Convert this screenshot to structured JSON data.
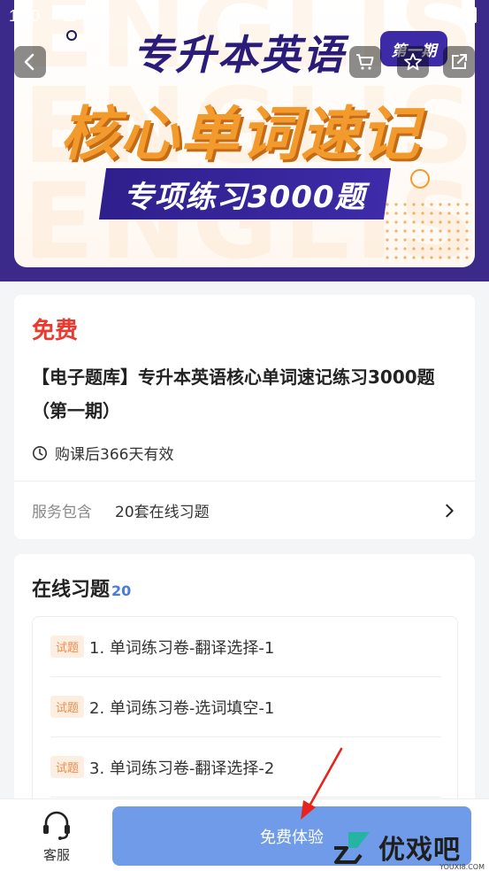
{
  "status_bar": {
    "time": "1:50"
  },
  "banner": {
    "title_line1": "专升本英语",
    "title_line2": "核心单词速记",
    "ribbon": "专项练习3000题",
    "issue_badge": "第一期",
    "watermark": "ENGLISH"
  },
  "course": {
    "price": "免费",
    "title": "【电子题库】专升本英语核心单词速记练习3000题（第一期）",
    "validity": "购课后366天有效",
    "service_label": "服务包含",
    "service_value": "20套在线习题"
  },
  "exercises": {
    "section_title": "在线习题",
    "count": "20",
    "items": [
      {
        "tag": "试题",
        "text": "1. 单词练习卷-翻译选择-1"
      },
      {
        "tag": "试题",
        "text": "2. 单词练习卷-选词填空-1"
      },
      {
        "tag": "试题",
        "text": "3. 单词练习卷-翻译选择-2"
      }
    ]
  },
  "bottom_bar": {
    "customer_service_label": "客服",
    "trial_button_label": "免费体验"
  },
  "watermark": {
    "brand": "优戏吧",
    "site": "YOUXI8.COM"
  },
  "colors": {
    "banner_bg": "#3b2a8a",
    "price_red": "#e83a2e",
    "trial_button": "#6f9be8",
    "accent_orange": "#f39a2d",
    "count_blue": "#4a7bd8"
  }
}
